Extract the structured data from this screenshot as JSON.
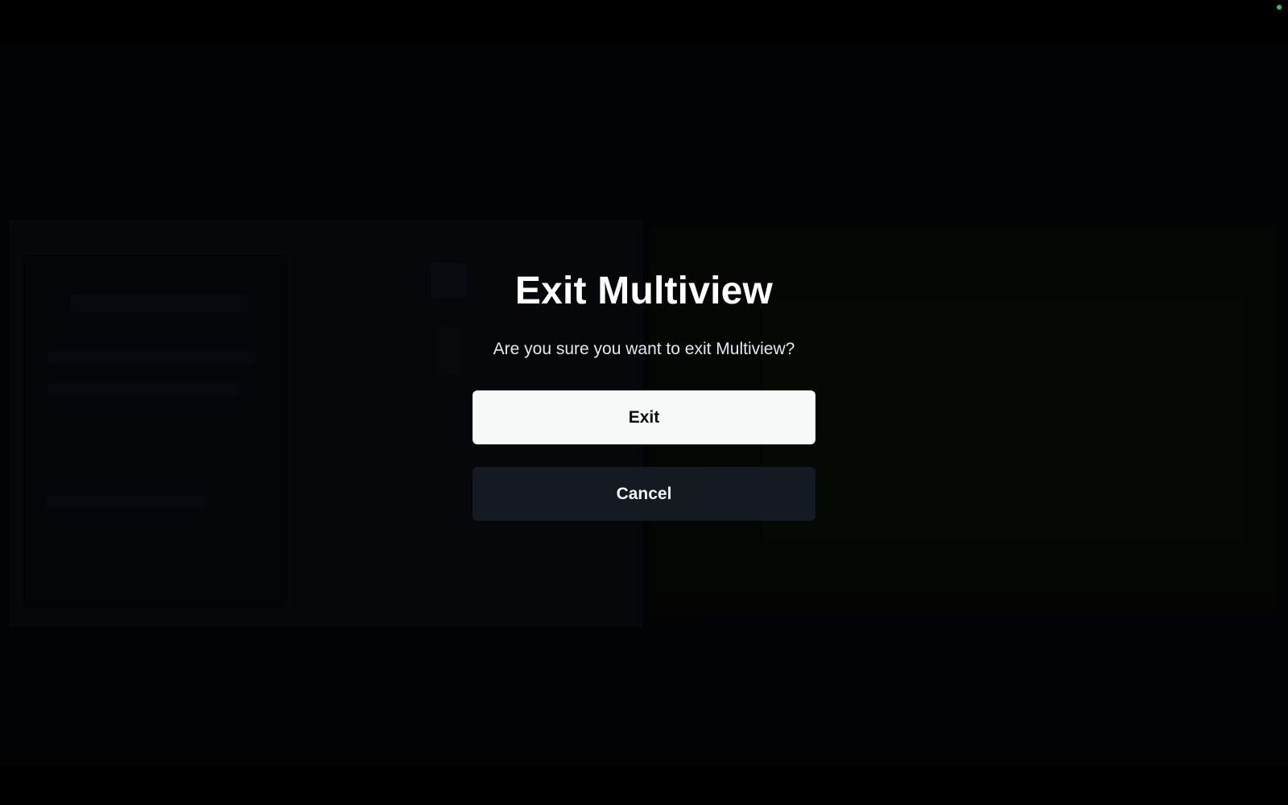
{
  "dialog": {
    "title": "Exit Multiview",
    "message": "Are you sure you want to exit Multiview?",
    "exit_label": "Exit",
    "cancel_label": "Cancel"
  },
  "colors": {
    "background": "#000000",
    "primary_button": "#f7f8f8",
    "secondary_button": "#161a22",
    "status_indicator": "#22c55e"
  }
}
